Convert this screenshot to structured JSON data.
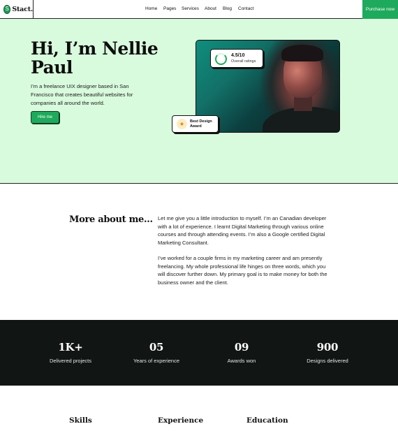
{
  "header": {
    "logo_mark": "S",
    "logo_text": "Stact.",
    "nav": [
      "Home",
      "Pages",
      "Services",
      "About",
      "Blog",
      "Contact"
    ],
    "cta": "Purchase now"
  },
  "hero": {
    "title": "Hi, I’m Nellie Paul",
    "description": "I’m a freelance UIX designer based in San Francisco that creates beautiful websites for companies all around the world.",
    "button": "Hire me",
    "rating_value": "4.5/10",
    "rating_label": "Overall ratings",
    "rating_fraction": 0.45,
    "award_icon": "trophy-icon",
    "award_label": "Best Design Award"
  },
  "about": {
    "title": "More about me...",
    "paragraph_1": "Let me give you a little introduction to myself. I’m an Canadian developer with a lot of experience. I learnt Digital Marketing through various online courses and through attending events. I’m also a Google certified Digital Marketing Consultant.",
    "paragraph_2": "I’ve worked for a couple firms in my marketing career and am presently freelancing. My whole professional life hinges on three words, which you will discover further down. My primary goal is to make money for both the business owner and the client."
  },
  "stats": [
    {
      "value": "1K+",
      "label": "Delivered projects"
    },
    {
      "value": "05",
      "label": "Years of experience"
    },
    {
      "value": "09",
      "label": "Awards won"
    },
    {
      "value": "900",
      "label": "Designs delivered"
    }
  ],
  "sections": {
    "skills": "Skills",
    "experience": "Experience",
    "education": "Education"
  },
  "colors": {
    "accent": "#1eaa5c",
    "hero_bg": "#d9fbdd",
    "stats_bg": "#111513"
  }
}
